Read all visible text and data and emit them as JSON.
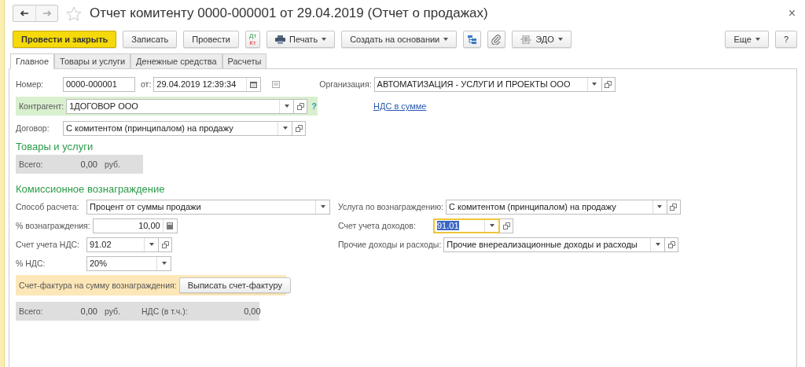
{
  "window": {
    "title": "Отчет комитенту 0000-000001 от 29.04.2019 (Отчет о продажах)",
    "close": "×"
  },
  "toolbar": [
    {
      "kind": "primary",
      "label": "Провести и закрыть"
    },
    {
      "kind": "plain",
      "label": "Записать"
    },
    {
      "kind": "plain",
      "label": "Провести"
    },
    {
      "kind": "dtkt",
      "top": "Дт",
      "bottom": "Кт"
    },
    {
      "kind": "print-menu",
      "label": "Печать"
    },
    {
      "kind": "menu",
      "label": "Создать на основании"
    },
    {
      "kind": "structure"
    },
    {
      "kind": "attach"
    },
    {
      "kind": "edo-menu",
      "label": "ЭДО"
    }
  ],
  "toolbar_right": [
    {
      "kind": "menu",
      "label": "Еще"
    },
    {
      "kind": "plain",
      "label": "?"
    }
  ],
  "tabs": [
    {
      "label": "Главное",
      "selected": true
    },
    {
      "label": "Товары и услуги",
      "selected": false
    },
    {
      "label": "Денежные средства",
      "selected": false
    },
    {
      "label": "Расчеты",
      "selected": false
    }
  ],
  "header": {
    "number": {
      "label": "Номер:",
      "value": "0000-000001"
    },
    "date": {
      "label": "от:",
      "value": "29.04.2019 12:39:34"
    },
    "organization": {
      "label": "Организация:",
      "value": "АВТОМАТИЗАЦИЯ - УСЛУГИ И ПРОЕКТЫ ООО"
    },
    "counterparty": {
      "label": "Контрагент:",
      "value": "1ДОГОВОР ООО",
      "help": "?"
    },
    "vat_link": "НДС в сумме",
    "contract": {
      "label": "Договор:",
      "value": "С комитентом (принципалом) на продажу"
    }
  },
  "goods": {
    "title": "Товары и услуги",
    "total_label": "Всего:",
    "total": "0,00",
    "currency": "руб."
  },
  "commission": {
    "title": "Комиссионное вознаграждение",
    "left": [
      {
        "kind": "select",
        "label": "Способ расчета:",
        "value": "Процент от суммы продажи",
        "focused": false
      },
      {
        "kind": "number",
        "label": "% вознаграждения:",
        "value": "10,00",
        "focused": false
      },
      {
        "kind": "combo",
        "label": "Счет учета НДС:",
        "value": "91.02",
        "focused": false
      },
      {
        "kind": "select",
        "label": "% НДС:",
        "value": "20%",
        "focused": false
      }
    ],
    "right": [
      {
        "kind": "combo",
        "label": "Услуга по вознаграждению:",
        "value": "С комитентом (принципалом) на продажу",
        "focused": false
      },
      {
        "kind": "combo",
        "label": "Счет учета доходов:",
        "value": "91.01",
        "focused": true
      },
      {
        "kind": "combo",
        "label": "Прочие доходы и расходы:",
        "value": "Прочие внереализационные доходы и расходы",
        "focused": false
      }
    ],
    "invoice": {
      "label": "Счет-фактура на сумму вознаграждения:",
      "button": "Выписать счет-фактуру"
    },
    "totals": {
      "total_label": "Всего:",
      "total": "0,00",
      "currency": "руб.",
      "vat_label": "НДС (в т.ч.):",
      "vat": "0,00"
    }
  }
}
